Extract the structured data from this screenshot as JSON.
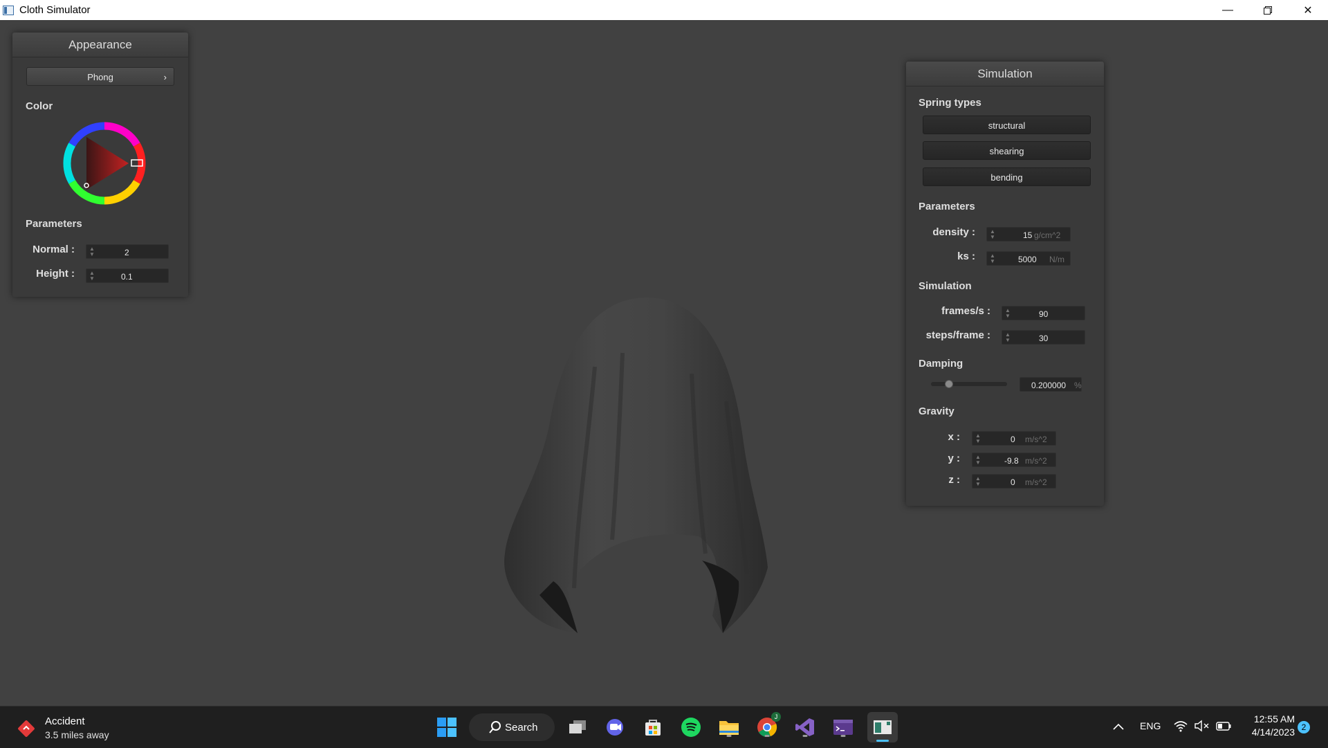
{
  "window": {
    "title": "Cloth Simulator"
  },
  "appearance": {
    "title": "Appearance",
    "shading": "Phong",
    "color_label": "Color",
    "selected_color": "#c42222",
    "params_label": "Parameters",
    "normal": {
      "label": "Normal :",
      "value": "2"
    },
    "height": {
      "label": "Height :",
      "value": "0.1"
    }
  },
  "simulation": {
    "title": "Simulation",
    "spring_label": "Spring types",
    "springs": [
      "structural",
      "shearing",
      "bending"
    ],
    "params_label": "Parameters",
    "density": {
      "label": "density :",
      "value": "15",
      "unit": "g/cm^2"
    },
    "ks": {
      "label": "ks :",
      "value": "5000",
      "unit": "N/m"
    },
    "sim_label": "Simulation",
    "fps": {
      "label": "frames/s :",
      "value": "90"
    },
    "steps": {
      "label": "steps/frame :",
      "value": "30"
    },
    "damping_label": "Damping",
    "damping": {
      "value": "0.200000",
      "unit": "%",
      "fraction": 0.2
    },
    "gravity_label": "Gravity",
    "gx": {
      "label": "x :",
      "value": "0",
      "unit": "m/s^2"
    },
    "gy": {
      "label": "y :",
      "value": "-9.8",
      "unit": "m/s^2"
    },
    "gz": {
      "label": "z :",
      "value": "0",
      "unit": "m/s^2"
    }
  },
  "taskbar": {
    "notification_title": "Accident",
    "notification_sub": "3.5 miles away",
    "search_label": "Search",
    "language": "ENG",
    "time": "12:55 AM",
    "date": "4/14/2023",
    "badge": "2",
    "chrome_badge": "J"
  }
}
